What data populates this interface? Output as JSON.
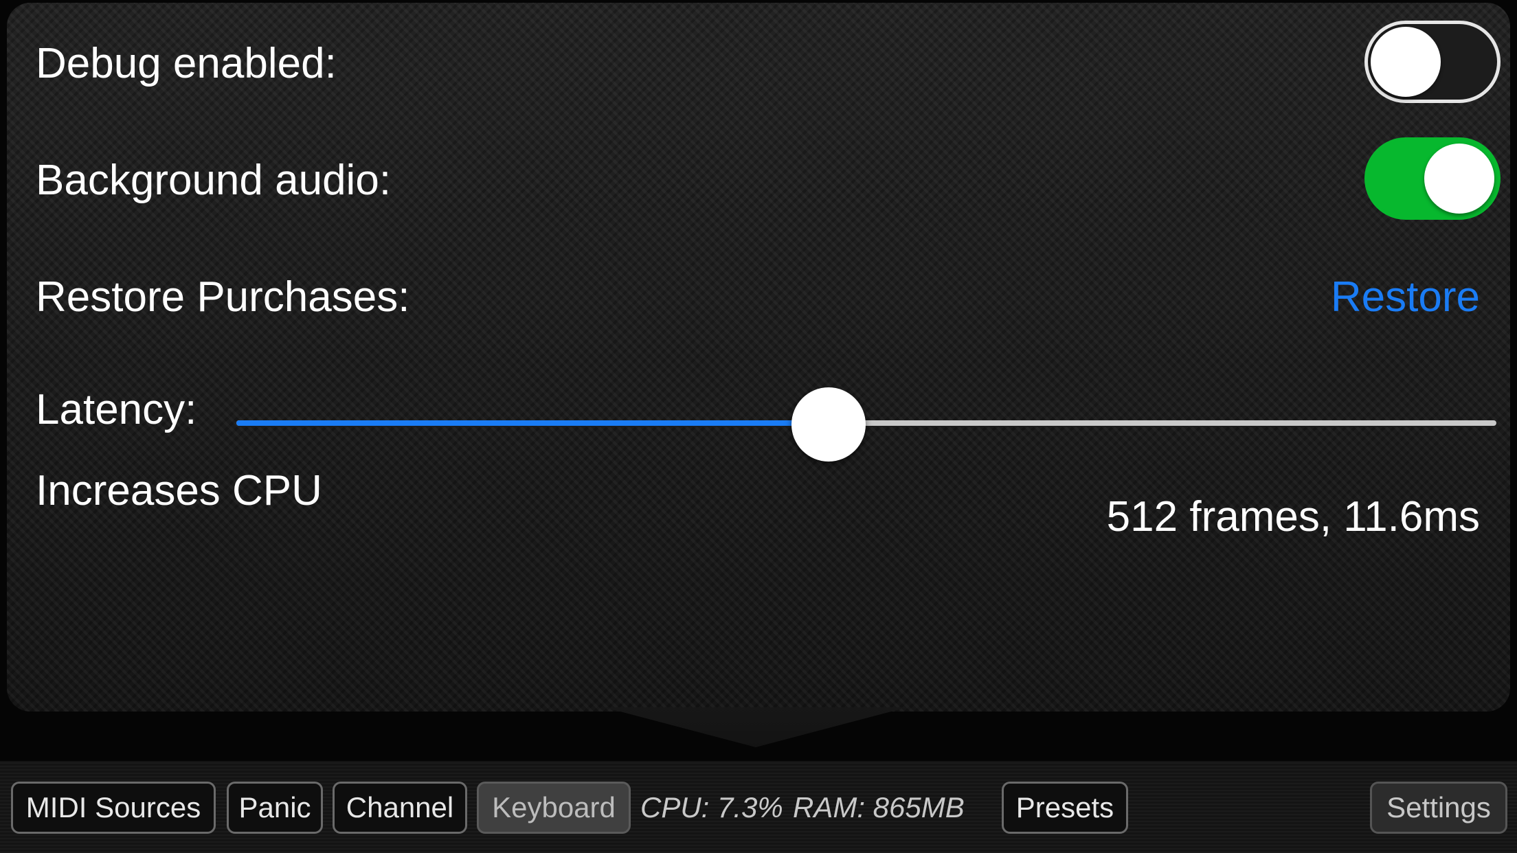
{
  "settings": {
    "debug": {
      "label": "Debug enabled:",
      "enabled": false
    },
    "background_audio": {
      "label": "Background audio:",
      "enabled": true
    },
    "restore": {
      "label": "Restore Purchases:",
      "action": "Restore"
    },
    "latency": {
      "label": "Latency:",
      "note": "Increases CPU",
      "value_text": "512 frames, 11.6ms",
      "slider_fraction": 0.47
    }
  },
  "toolbar": {
    "midi_sources": "MIDI Sources",
    "panic": "Panic",
    "channel": "Channel",
    "keyboard": "Keyboard",
    "cpu": "CPU: 7.3%",
    "ram": "RAM: 865MB",
    "presets": "Presets",
    "settings": "Settings"
  },
  "colors": {
    "accent": "#1a7cf5",
    "toggle_on": "#07b82e"
  }
}
